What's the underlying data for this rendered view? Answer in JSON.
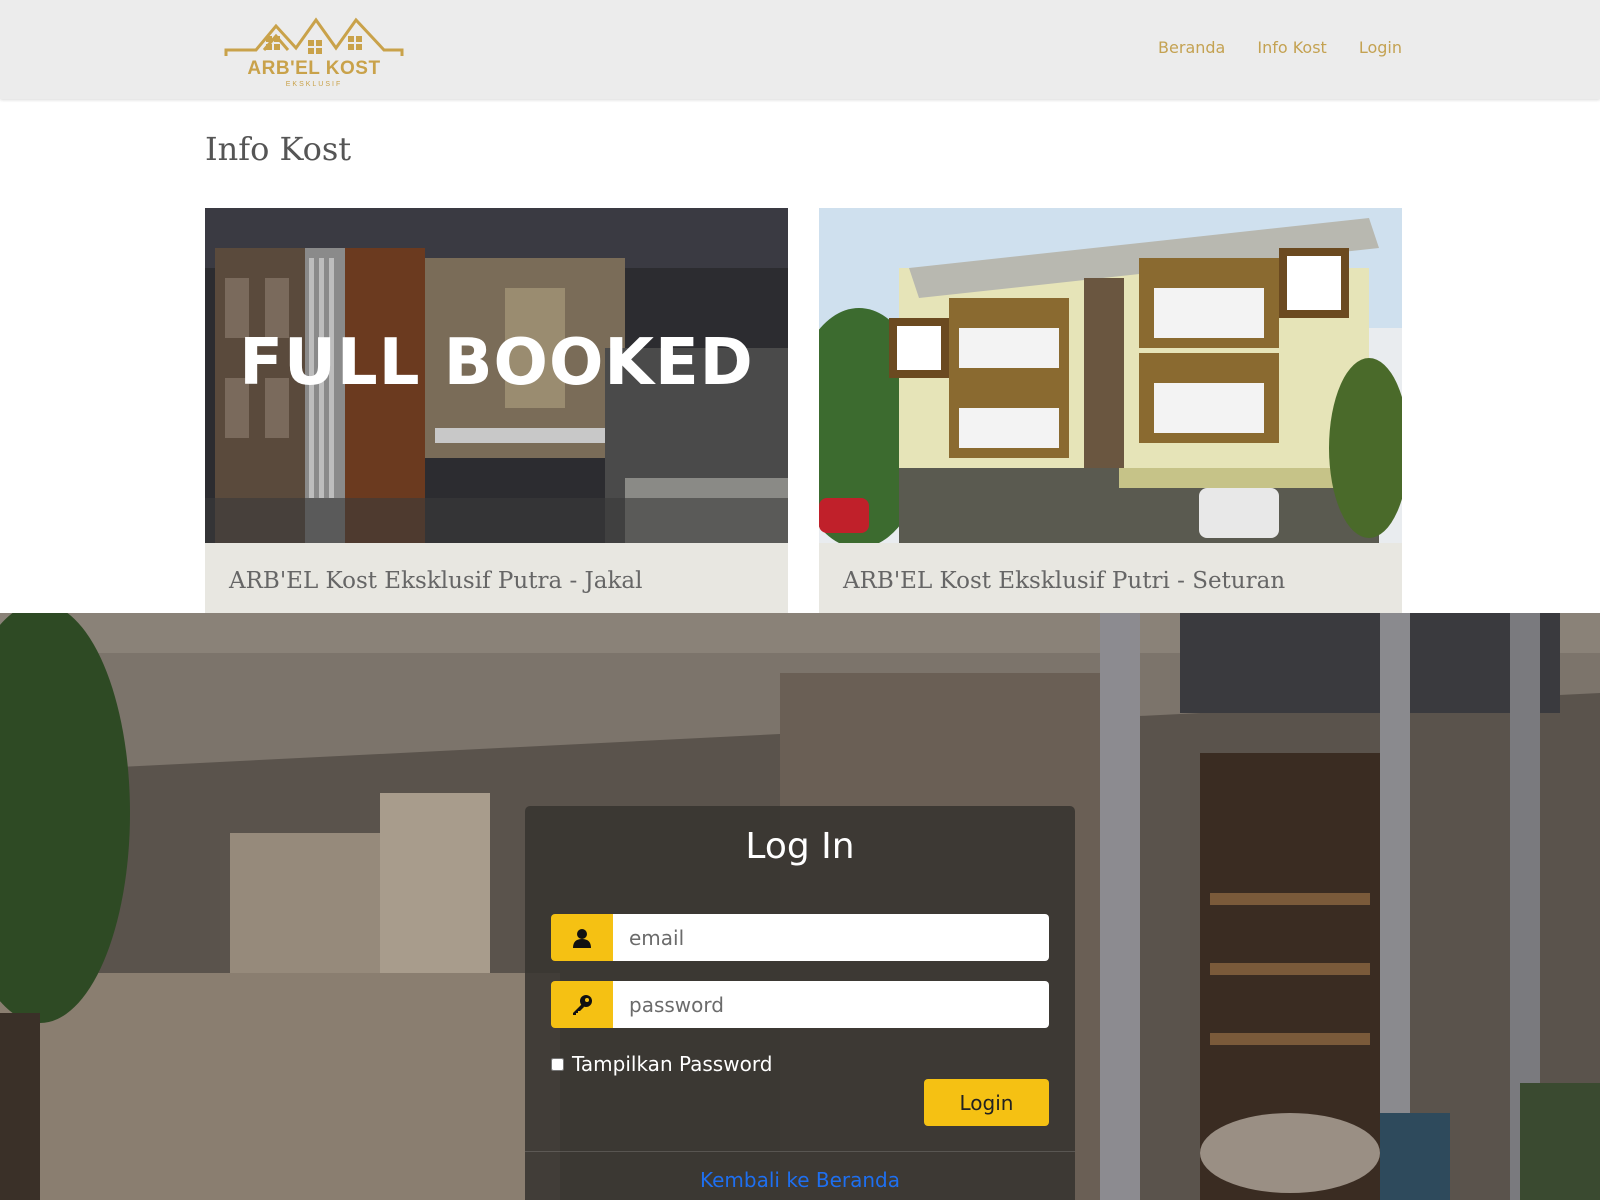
{
  "header": {
    "logo_text": "ARB'EL KOST",
    "logo_sub": "EKSKLUSIF",
    "nav": [
      {
        "label": "Beranda"
      },
      {
        "label": "Info Kost"
      },
      {
        "label": "Login"
      }
    ]
  },
  "info": {
    "title": "Info Kost",
    "cards": [
      {
        "title": "ARB'EL Kost Eksklusif Putra - Jakal",
        "overlay": "FULL BOOKED"
      },
      {
        "title": "ARB'EL Kost Eksklusif Putri - Seturan"
      }
    ]
  },
  "login": {
    "heading": "Log In",
    "email_placeholder": "email",
    "password_placeholder": "password",
    "show_password_label": "Tampilkan Password",
    "submit_label": "Login",
    "back_link": "Kembali ke Beranda"
  },
  "colors": {
    "accent": "#f5c113",
    "brand_gold": "#c9a24a",
    "link_blue": "#1e6ff0",
    "navbar_bg": "#ececec",
    "card_bg": "#e8e7e1"
  },
  "icons": {
    "email_icon": "user-icon",
    "password_icon": "key-icon",
    "logo": "houses-logo-icon"
  }
}
